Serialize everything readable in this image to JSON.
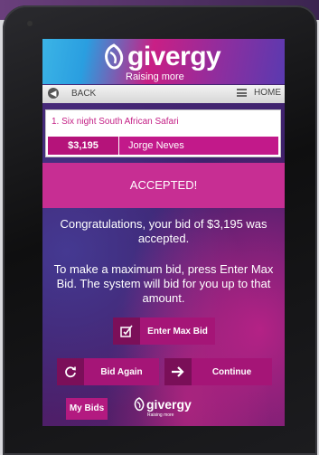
{
  "header": {
    "logo_text": "givergy",
    "tagline": "Raising more"
  },
  "nav": {
    "back_label": "BACK",
    "home_label": "HOME"
  },
  "item": {
    "title": "1. Six night South African Safari",
    "price": "$3,195",
    "bidder": "Jorge Neves"
  },
  "status": {
    "accepted_label": "ACCEPTED!"
  },
  "messages": {
    "congrats": "Congratulations, your bid of $3,195 was accepted.",
    "max_bid_info": "To make a maximum bid, press Enter Max Bid. The system will bid for you up to that amount."
  },
  "buttons": {
    "enter_max_bid": "Enter Max Bid",
    "bid_again": "Bid Again",
    "continue": "Continue",
    "my_bids": "My Bids"
  },
  "footer": {
    "logo_text": "givergy",
    "tagline": "Raising more"
  },
  "colors": {
    "brand_magenta": "#c72e93",
    "brand_dark": "#7b0f59",
    "nav_bg": "#e6e6e6"
  },
  "icons": {
    "back": "arrow-left-circle-icon",
    "home": "menu-icon",
    "max_bid": "checkbox-pencil-icon",
    "bid_again": "refresh-icon",
    "continue": "arrow-right-icon"
  }
}
